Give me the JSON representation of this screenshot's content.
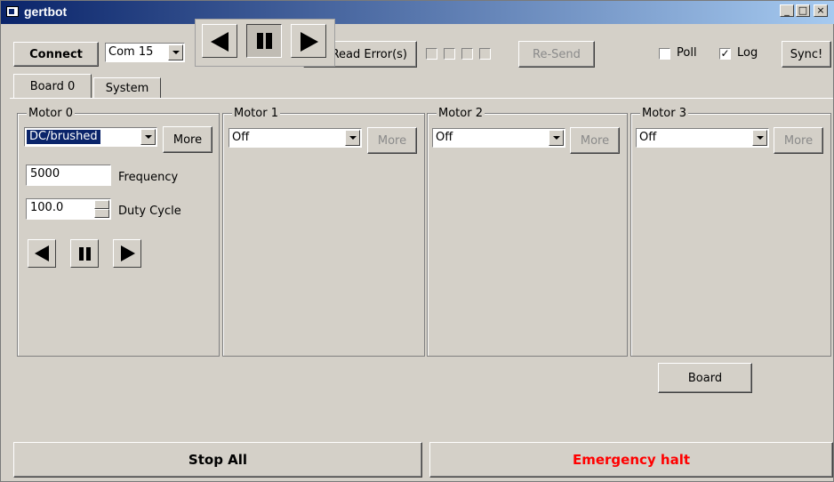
{
  "window": {
    "title": "gertbot",
    "min_glyph": "_",
    "max_glyph": "□",
    "close_glyph": "×"
  },
  "toolbar": {
    "connect_label": "Connect",
    "com_port": "Com 15",
    "read_errors_label": "Read Error(s)",
    "resend_label": "Re-Send",
    "poll_label": "Poll",
    "poll_checked": false,
    "log_label": "Log",
    "log_checked": true,
    "sync_label": "Sync!"
  },
  "tabs": [
    {
      "label": "Board 0",
      "active": true
    },
    {
      "label": "System",
      "active": false
    }
  ],
  "motors": [
    {
      "title": "Motor 0",
      "mode": "DC/brushed",
      "more_label": "More",
      "frequency_value": "5000",
      "frequency_label": "Frequency",
      "duty_value": "100.0",
      "duty_label": "Duty Cycle"
    },
    {
      "title": "Motor 1",
      "mode": "Off",
      "more_label": "More"
    },
    {
      "title": "Motor 2",
      "mode": "Off",
      "more_label": "More"
    },
    {
      "title": "Motor 3",
      "mode": "Off",
      "more_label": "More"
    }
  ],
  "board_button_label": "Board",
  "footer": {
    "stop_all_label": "Stop All",
    "emergency_label": "Emergency halt",
    "emergency_color": "#ff0000"
  },
  "icons": {
    "reverse": "left-triangle-icon",
    "pause": "pause-icon",
    "forward": "right-triangle-icon"
  }
}
